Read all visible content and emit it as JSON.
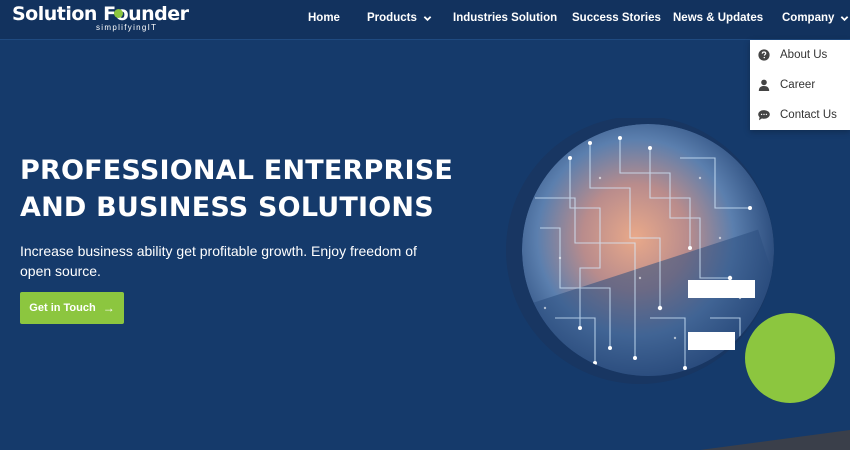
{
  "logo": {
    "main_text": "Solution Founder",
    "main_left": "Solution ",
    "main_right": "ounder",
    "tagline": "simplifyingIT"
  },
  "nav": {
    "items": [
      {
        "label": "Home"
      },
      {
        "label": "Products"
      },
      {
        "label": "Industries Solution"
      },
      {
        "label": "Success Stories"
      },
      {
        "label": "News & Updates"
      },
      {
        "label": "Company"
      }
    ]
  },
  "company_menu": {
    "items": [
      {
        "label": "About Us",
        "icon": "question-circle-icon"
      },
      {
        "label": "Career",
        "icon": "user-icon"
      },
      {
        "label": "Contact Us",
        "icon": "comment-icon"
      }
    ]
  },
  "hero": {
    "title_line1": "PROFESSIONAL ENTERPRISE",
    "title_line2": "AND BUSINESS SOLUTIONS",
    "subtitle": "Increase business ability get profitable growth. Enjoy freedom of open source.",
    "cta_label": "Get in Touch",
    "cta_icon": "arrow-right-icon"
  },
  "colors": {
    "background": "#153a6b",
    "header": "#12325e",
    "accent_green": "#8cc63f",
    "dropdown_bg": "#ffffff"
  }
}
